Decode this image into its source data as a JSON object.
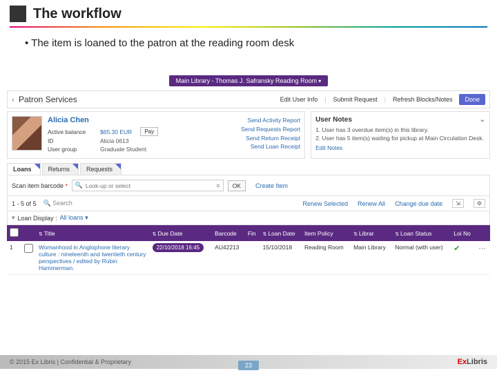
{
  "slide": {
    "title": "The workflow",
    "bullet": "The item is loaned to the patron at the reading room desk",
    "footer_copyright": "© 2015 Ex Libris | Confidential & Proprietary",
    "page_number": "23",
    "logo_text": "ExLibris"
  },
  "location_bar": "Main Library - Thomas J. Safransky Reading Room",
  "patron_services": {
    "title": "Patron Services",
    "actions": {
      "edit": "Edit User Info",
      "submit": "Submit Request",
      "refresh": "Refresh Blocks/Notes",
      "done": "Done"
    }
  },
  "user": {
    "name": "Alicia Chen",
    "balance_label": "Active balance",
    "balance_value": "$65.30 EUR",
    "pay": "Pay",
    "id_label": "ID",
    "id_value": "Alicia 0613",
    "group_label": "User group",
    "group_value": "Graduate Student",
    "quicklinks": {
      "activity": "Send Activity Report",
      "requests": "Send Requests Report",
      "return": "Send Return Receipt",
      "loan": "Send Loan Receipt"
    }
  },
  "notes": {
    "title": "User Notes",
    "items": [
      "1. User has 3 overdue item(s) in this library.",
      "2. User has 5 item(s) waiting for pickup at Main Circulation Desk."
    ],
    "edit": "Edit Notes"
  },
  "tabs": {
    "loans": "Loans",
    "returns": "Returns",
    "requests": "Requests"
  },
  "scan": {
    "label": "Scan item barcode",
    "placeholder": "Look-up or select",
    "ok": "OK",
    "create": "Create Item"
  },
  "list": {
    "count": "1 - 5 of 5",
    "search_icon_label": "Search",
    "renew_selected": "Renew Selected",
    "renew_all": "Renew All",
    "change_due": "Change due date"
  },
  "loan_display": {
    "label": "Loan Display :",
    "value": "All loans"
  },
  "table": {
    "headers": {
      "title": "Title",
      "due": "Due Date",
      "barcode": "Barcode",
      "fine": "Fin",
      "loan_date": "Loan Date",
      "policy": "Item Policy",
      "library": "Librar",
      "status": "Loan Status",
      "notes": "Loi No"
    },
    "row": {
      "index": "1",
      "title": "Womanhood in Anglophone literary culture : nineteenth and twentieth century perspectives / edited by Robin Hammerman.",
      "due": "22/10/2018 16:45",
      "barcode": "AU42213",
      "loan_date": "15/10/2018",
      "policy": "Reading Room",
      "library": "Main Library",
      "status": "Normal (with user)"
    }
  }
}
